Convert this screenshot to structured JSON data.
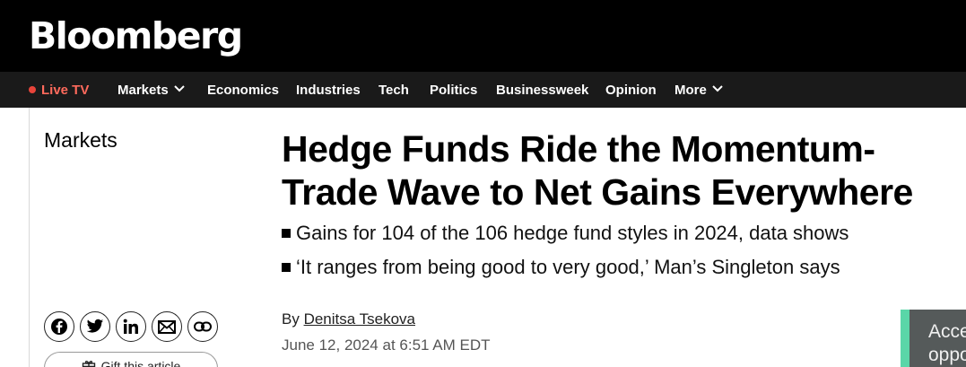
{
  "brand": {
    "logo": "Bloomberg"
  },
  "nav": {
    "live_tv": "Live TV",
    "items": [
      "Markets",
      "Economics",
      "Industries",
      "Tech",
      "Politics",
      "Businessweek",
      "Opinion",
      "More"
    ]
  },
  "article": {
    "section": "Markets",
    "headline_line1": "Hedge Funds Ride the Momentum-",
    "headline_line2": "Trade Wave to Net Gains Everywhere",
    "bullets": [
      "Gains for 104 of the 106 hedge fund styles in 2024, data shows",
      "‘It ranges from being good to very good,’ Man’s Singleton says"
    ],
    "byline_prefix": "By ",
    "author": "Denitsa Tsekova",
    "date": "June 12, 2024 at 6:51 AM EDT"
  },
  "share": {
    "icons": [
      "facebook-icon",
      "twitter-icon",
      "linkedin-icon",
      "email-icon",
      "link-icon"
    ],
    "gift_label": "Gift this article"
  },
  "side_panel": {
    "line1": "Acce",
    "line2": "oppo"
  },
  "colors": {
    "topbar": "#000000",
    "navbar": "#1a1a1a",
    "live": "#e8443a",
    "accent": "#5ad6a8"
  }
}
